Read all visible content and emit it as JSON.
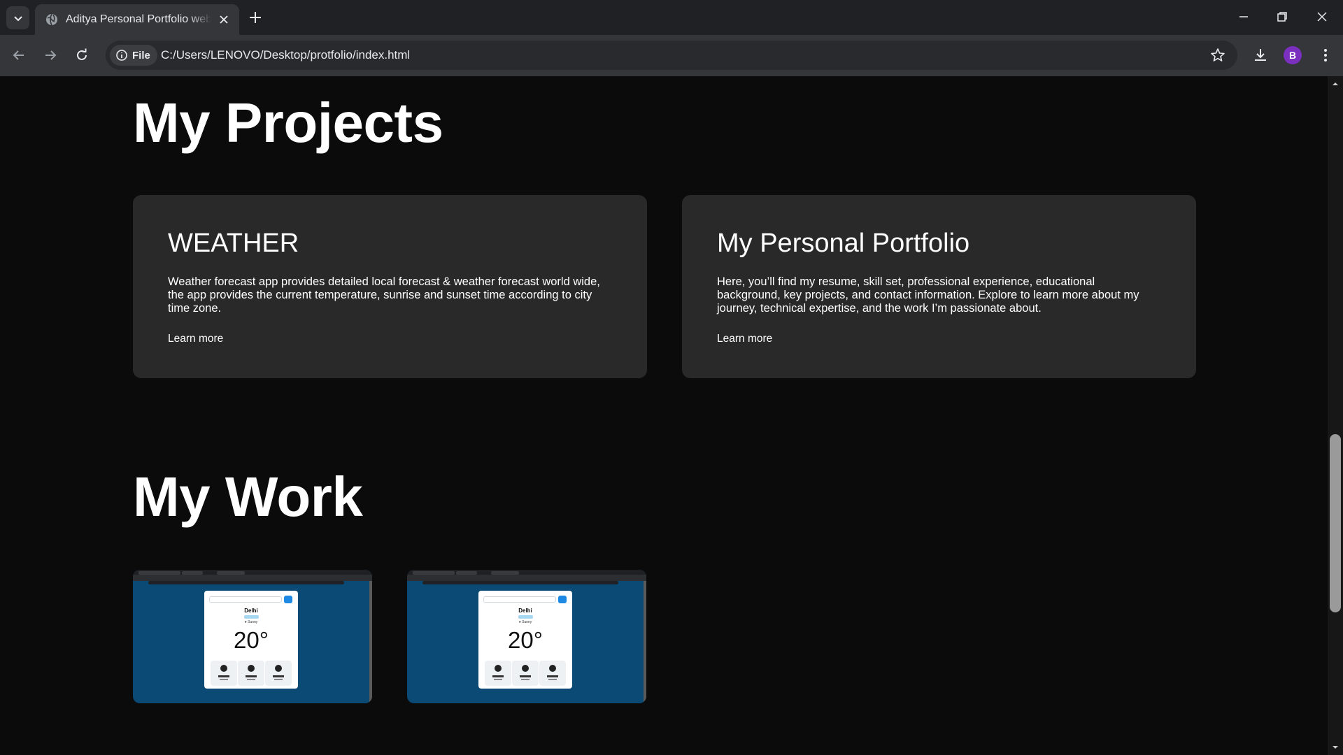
{
  "browser": {
    "tab_title": "Aditya Personal Portfolio website",
    "chip_label": "File",
    "url": "C:/Users/LENOVO/Desktop/protfolio/index.html",
    "profile_initial": "B",
    "profile_color": "#7b2fbe"
  },
  "projects": {
    "heading": "My Projects",
    "cards": [
      {
        "title": "WEATHER",
        "description": "Weather forecast app provides detailed local forecast & weather forecast world wide, the app provides the current temperature, sunrise and sunset time according to city time zone.",
        "link": "Learn more"
      },
      {
        "title": "My Personal Portfolio",
        "description": "Here, you’ll find my resume, skill set, professional experience, educational background, key projects, and contact information. Explore to learn more about my journey, technical expertise, and the work I’m passionate about.",
        "link": "Learn more"
      }
    ]
  },
  "work": {
    "heading": "My Work",
    "thumbnails": [
      {
        "city": "Delhi",
        "condition": "Sunny",
        "temperature": "20°"
      },
      {
        "city": "Delhi",
        "condition": "Sunny",
        "temperature": "20°"
      }
    ]
  },
  "colors": {
    "page_background": "#0b0b0b",
    "card_background": "#292929",
    "thumbnail_background": "#0a4a74"
  }
}
